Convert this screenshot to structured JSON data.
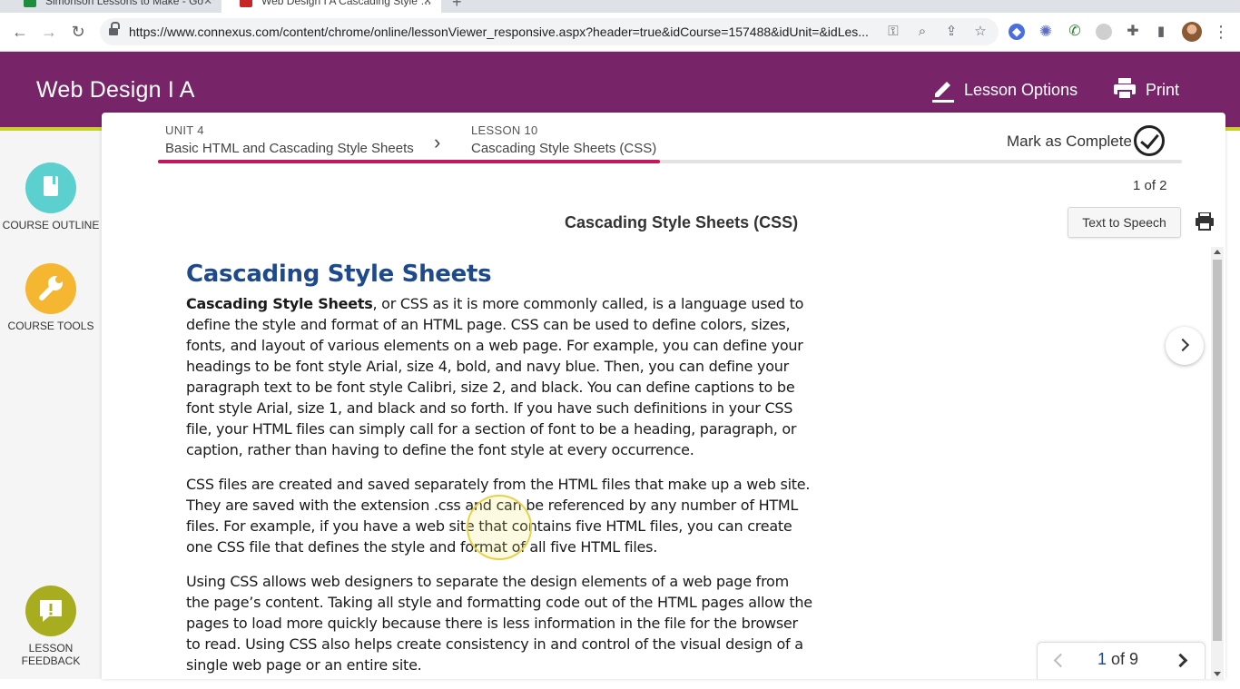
{
  "browser": {
    "tabs": [
      {
        "title": "Simonson Lessons to Make - Go",
        "color": "#1e8e3e"
      },
      {
        "title": "Web Design I A Cascading Style Sheets",
        "color": "#c62828"
      }
    ],
    "url": "https://www.connexus.com/content/chrome/online/lessonViewer_responsive.aspx?header=true&idCourse=157488&idUnit=&idLes..."
  },
  "header": {
    "title": "Web Design I A",
    "lesson_options": "Lesson Options",
    "print": "Print"
  },
  "rail": {
    "outline": "COURSE OUTLINE",
    "tools": "COURSE TOOLS",
    "feedback_line1": "LESSON",
    "feedback_line2": "FEEDBACK"
  },
  "breadcrumb": {
    "unit_label": "UNIT 4",
    "unit_title": "Basic HTML and Cascading Style Sheets",
    "lesson_label": "LESSON 10",
    "lesson_title": "Cascading Style Sheets (CSS)",
    "progress_fraction": 0.49
  },
  "mark_complete": "Mark as Complete",
  "page_indicator": "1 of 2",
  "lesson_heading": "Cascading Style Sheets (CSS)",
  "text_to_speech": "Text to Speech",
  "content": {
    "heading": "Cascading Style Sheets",
    "p1_bold": "Cascading Style Sheets",
    "p1_rest": ", or CSS as it is more commonly called, is a language used to define the style and format of an HTML page. CSS can be used to define colors, sizes, fonts, and layout of various elements on a web page. For example, you can define your headings to be font style Arial, size 4, bold, and navy blue. Then, you can define your paragraph text to be font style Calibri, size 2, and black. You can define captions to be font style Arial, size 1, and black and so forth. If you have such definitions in your CSS file, your HTML files can simply call for a section of font to be a heading, paragraph, or caption, rather than having to define the font style at every occurrence.",
    "p2": "CSS files are created and saved separately from the HTML files that make up a web site. They are saved with the extension .css and can be referenced by any number of HTML files. For example, if you have a web site that contains five HTML files, you can create one CSS file that defines the style and format of all five HTML files.",
    "p3": "Using CSS allows web designers to separate the design elements of a web page from the page’s content. Taking all style and formatting code out of the HTML pages allow the pages to load more quickly because there is less information in the file for the browser to read. Using CSS also helps create consistency in and control of the visual design of a single web page or an entire site."
  },
  "pager": {
    "current": "1",
    "of_total": " of 9"
  },
  "colors": {
    "header": "#772568",
    "accent_line": "#c9d02b",
    "progress": "#c2185b",
    "outline": "#5ccfcf",
    "tools": "#f5b731",
    "feedback": "#a8ad1f",
    "heading": "#1e4a8c"
  }
}
